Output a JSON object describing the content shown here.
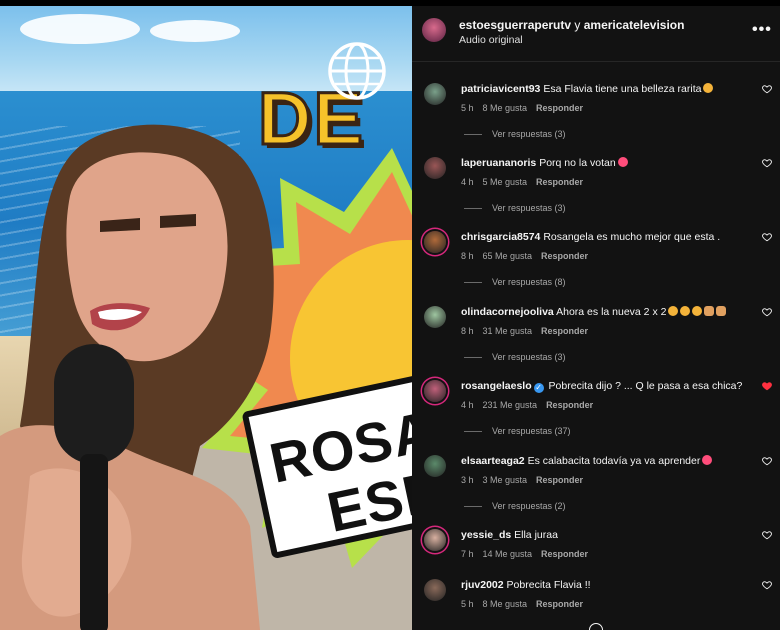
{
  "post": {
    "author_primary": "estoesguerraperutv",
    "author_conjunction": "y",
    "author_secondary": "americatelevision",
    "audio_label": "Audio original"
  },
  "sign": {
    "line1": "ROSA",
    "line2": "ESP"
  },
  "show_logo_text": "DE",
  "comments": [
    {
      "user": "patriciavicent93",
      "verified": false,
      "text": "Esa Flavia tiene una belleza rarita",
      "emojis": [
        "laugh"
      ],
      "time": "5 h",
      "likes": "8 Me gusta",
      "reply": "Responder",
      "replies": "Ver respuestas (3)",
      "liked": false,
      "avatar_color": "#7aa08a",
      "ring": false
    },
    {
      "user": "laperuananoris",
      "verified": false,
      "text": "Porq no la votan",
      "emojis": [
        "love"
      ],
      "time": "4 h",
      "likes": "5 Me gusta",
      "reply": "Responder",
      "replies": "Ver respuestas (3)",
      "liked": false,
      "avatar_color": "#9a5656",
      "ring": false
    },
    {
      "user": "chrisgarcia8574",
      "verified": false,
      "text": "Rosangela es mucho mejor que esta .",
      "emojis": [],
      "time": "8 h",
      "likes": "65 Me gusta",
      "reply": "Responder",
      "replies": "Ver respuestas (8)",
      "liked": false,
      "avatar_color": "#b06a3a",
      "ring": true
    },
    {
      "user": "olindacornejooliva",
      "verified": false,
      "text": "Ahora es la nueva 2 x 2",
      "emojis": [
        "laugh",
        "laugh",
        "laugh",
        "shrug",
        "shrug"
      ],
      "time": "8 h",
      "likes": "31 Me gusta",
      "reply": "Responder",
      "replies": "Ver respuestas (3)",
      "liked": false,
      "avatar_color": "#9ec6a0",
      "ring": false
    },
    {
      "user": "rosangelaeslo",
      "verified": true,
      "text": "Pobrecita dijo ? ... Q le pasa a esa chica?",
      "emojis": [],
      "time": "4 h",
      "likes": "231 Me gusta",
      "reply": "Responder",
      "replies": "Ver respuestas (37)",
      "liked": true,
      "avatar_color": "#c0607a",
      "ring": true
    },
    {
      "user": "elsaarteaga2",
      "verified": false,
      "text": "Es calabacita todavía ya va aprender",
      "emojis": [
        "love"
      ],
      "time": "3 h",
      "likes": "3 Me gusta",
      "reply": "Responder",
      "replies": "Ver respuestas (2)",
      "liked": false,
      "avatar_color": "#5b8a6a",
      "ring": false
    },
    {
      "user": "yessie_ds",
      "verified": false,
      "text": "Ella juraa",
      "emojis": [],
      "time": "7 h",
      "likes": "14 Me gusta",
      "reply": "Responder",
      "replies": "",
      "liked": false,
      "avatar_color": "#d8b0a0",
      "ring": true
    },
    {
      "user": "rjuv2002",
      "verified": false,
      "text": "Pobrecita Flavia !!",
      "emojis": [],
      "time": "5 h",
      "likes": "8 Me gusta",
      "reply": "Responder",
      "replies": "",
      "liked": false,
      "avatar_color": "#8a6a5a",
      "ring": false
    }
  ],
  "colors": {
    "panel_bg": "#121212",
    "liked_heart": "#ff3040",
    "ring": "#d6287c",
    "verified": "#3897f0"
  }
}
